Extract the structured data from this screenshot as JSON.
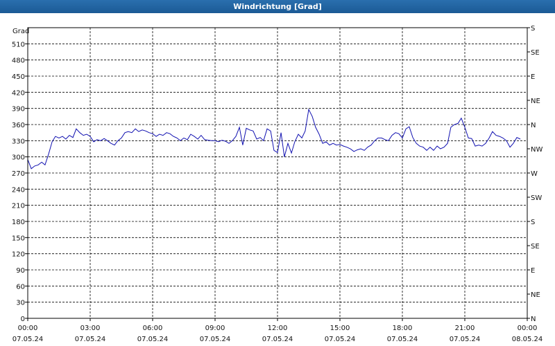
{
  "window": {
    "title": "Windrichtung [Grad]"
  },
  "chart_data": {
    "type": "line",
    "title": "Windrichtung [Grad]",
    "ylabel": "Grad",
    "ylim": [
      0,
      540
    ],
    "yticks": [
      0,
      30,
      60,
      90,
      120,
      150,
      180,
      210,
      240,
      270,
      300,
      330,
      360,
      390,
      420,
      450,
      480,
      510
    ],
    "right_labels": [
      {
        "v": 0,
        "label": "N"
      },
      {
        "v": 45,
        "label": "NE"
      },
      {
        "v": 90,
        "label": "E"
      },
      {
        "v": 135,
        "label": "SE"
      },
      {
        "v": 180,
        "label": "S"
      },
      {
        "v": 225,
        "label": "SW"
      },
      {
        "v": 270,
        "label": "W"
      },
      {
        "v": 315,
        "label": "NW"
      },
      {
        "v": 360,
        "label": "N"
      },
      {
        "v": 405,
        "label": "NE"
      },
      {
        "v": 450,
        "label": "E"
      },
      {
        "v": 495,
        "label": "SE"
      },
      {
        "v": 540,
        "label": "S"
      }
    ],
    "xlim": [
      0,
      24
    ],
    "xticks": [
      {
        "h": 0,
        "time": "00:00",
        "date": "07.05.24"
      },
      {
        "h": 3,
        "time": "03:00",
        "date": "07.05.24"
      },
      {
        "h": 6,
        "time": "06:00",
        "date": "07.05.24"
      },
      {
        "h": 9,
        "time": "09:00",
        "date": "07.05.24"
      },
      {
        "h": 12,
        "time": "12:00",
        "date": "07.05.24"
      },
      {
        "h": 15,
        "time": "15:00",
        "date": "07.05.24"
      },
      {
        "h": 18,
        "time": "18:00",
        "date": "07.05.24"
      },
      {
        "h": 21,
        "time": "21:00",
        "date": "07.05.24"
      },
      {
        "h": 24,
        "time": "00:00",
        "date": "08.05.24"
      }
    ],
    "grid": true,
    "series": [
      {
        "color": "#1010b0",
        "points": [
          [
            0.0,
            295
          ],
          [
            0.17,
            278
          ],
          [
            0.33,
            283
          ],
          [
            0.5,
            285
          ],
          [
            0.67,
            290
          ],
          [
            0.83,
            285
          ],
          [
            1.0,
            305
          ],
          [
            1.17,
            328
          ],
          [
            1.33,
            338
          ],
          [
            1.5,
            335
          ],
          [
            1.67,
            338
          ],
          [
            1.83,
            333
          ],
          [
            2.0,
            340
          ],
          [
            2.17,
            336
          ],
          [
            2.33,
            352
          ],
          [
            2.5,
            345
          ],
          [
            2.67,
            340
          ],
          [
            2.83,
            342
          ],
          [
            3.0,
            338
          ],
          [
            3.17,
            328
          ],
          [
            3.33,
            332
          ],
          [
            3.5,
            330
          ],
          [
            3.67,
            334
          ],
          [
            3.83,
            330
          ],
          [
            4.0,
            325
          ],
          [
            4.17,
            322
          ],
          [
            4.33,
            330
          ],
          [
            4.5,
            335
          ],
          [
            4.67,
            345
          ],
          [
            4.83,
            347
          ],
          [
            5.0,
            345
          ],
          [
            5.17,
            352
          ],
          [
            5.33,
            347
          ],
          [
            5.5,
            350
          ],
          [
            5.67,
            348
          ],
          [
            5.83,
            345
          ],
          [
            6.0,
            343
          ],
          [
            6.17,
            338
          ],
          [
            6.33,
            342
          ],
          [
            6.5,
            340
          ],
          [
            6.67,
            345
          ],
          [
            6.83,
            343
          ],
          [
            7.0,
            338
          ],
          [
            7.17,
            335
          ],
          [
            7.33,
            330
          ],
          [
            7.5,
            335
          ],
          [
            7.67,
            332
          ],
          [
            7.83,
            342
          ],
          [
            8.0,
            338
          ],
          [
            8.17,
            333
          ],
          [
            8.33,
            340
          ],
          [
            8.5,
            332
          ],
          [
            8.67,
            331
          ],
          [
            8.83,
            330
          ],
          [
            9.0,
            330
          ],
          [
            9.17,
            328
          ],
          [
            9.33,
            331
          ],
          [
            9.5,
            329
          ],
          [
            9.67,
            325
          ],
          [
            9.83,
            330
          ],
          [
            10.0,
            338
          ],
          [
            10.17,
            355
          ],
          [
            10.33,
            322
          ],
          [
            10.5,
            353
          ],
          [
            10.67,
            350
          ],
          [
            10.83,
            348
          ],
          [
            11.0,
            333
          ],
          [
            11.17,
            336
          ],
          [
            11.33,
            330
          ],
          [
            11.5,
            352
          ],
          [
            11.67,
            348
          ],
          [
            11.83,
            312
          ],
          [
            12.0,
            308
          ],
          [
            12.17,
            345
          ],
          [
            12.33,
            300
          ],
          [
            12.5,
            325
          ],
          [
            12.67,
            307
          ],
          [
            12.83,
            328
          ],
          [
            13.0,
            342
          ],
          [
            13.17,
            335
          ],
          [
            13.33,
            348
          ],
          [
            13.5,
            388
          ],
          [
            13.67,
            375
          ],
          [
            13.83,
            355
          ],
          [
            14.0,
            342
          ],
          [
            14.17,
            325
          ],
          [
            14.33,
            328
          ],
          [
            14.5,
            322
          ],
          [
            14.67,
            325
          ],
          [
            14.83,
            322
          ],
          [
            15.0,
            323
          ],
          [
            15.17,
            320
          ],
          [
            15.33,
            318
          ],
          [
            15.5,
            315
          ],
          [
            15.67,
            310
          ],
          [
            15.83,
            313
          ],
          [
            16.0,
            315
          ],
          [
            16.17,
            312
          ],
          [
            16.33,
            318
          ],
          [
            16.5,
            322
          ],
          [
            16.67,
            330
          ],
          [
            16.83,
            335
          ],
          [
            17.0,
            335
          ],
          [
            17.17,
            332
          ],
          [
            17.33,
            330
          ],
          [
            17.5,
            340
          ],
          [
            17.67,
            345
          ],
          [
            17.83,
            343
          ],
          [
            18.0,
            335
          ],
          [
            18.17,
            352
          ],
          [
            18.33,
            356
          ],
          [
            18.5,
            336
          ],
          [
            18.67,
            325
          ],
          [
            18.83,
            320
          ],
          [
            19.0,
            318
          ],
          [
            19.17,
            312
          ],
          [
            19.33,
            318
          ],
          [
            19.5,
            312
          ],
          [
            19.67,
            320
          ],
          [
            19.83,
            315
          ],
          [
            20.0,
            318
          ],
          [
            20.17,
            325
          ],
          [
            20.33,
            355
          ],
          [
            20.5,
            360
          ],
          [
            20.67,
            362
          ],
          [
            20.83,
            372
          ],
          [
            21.0,
            355
          ],
          [
            21.17,
            335
          ],
          [
            21.33,
            334
          ],
          [
            21.5,
            320
          ],
          [
            21.67,
            322
          ],
          [
            21.83,
            320
          ],
          [
            22.0,
            325
          ],
          [
            22.17,
            335
          ],
          [
            22.33,
            347
          ],
          [
            22.5,
            340
          ],
          [
            22.67,
            338
          ],
          [
            22.83,
            335
          ],
          [
            23.0,
            330
          ],
          [
            23.17,
            318
          ],
          [
            23.33,
            325
          ],
          [
            23.5,
            336
          ],
          [
            23.67,
            333
          ]
        ]
      }
    ]
  }
}
